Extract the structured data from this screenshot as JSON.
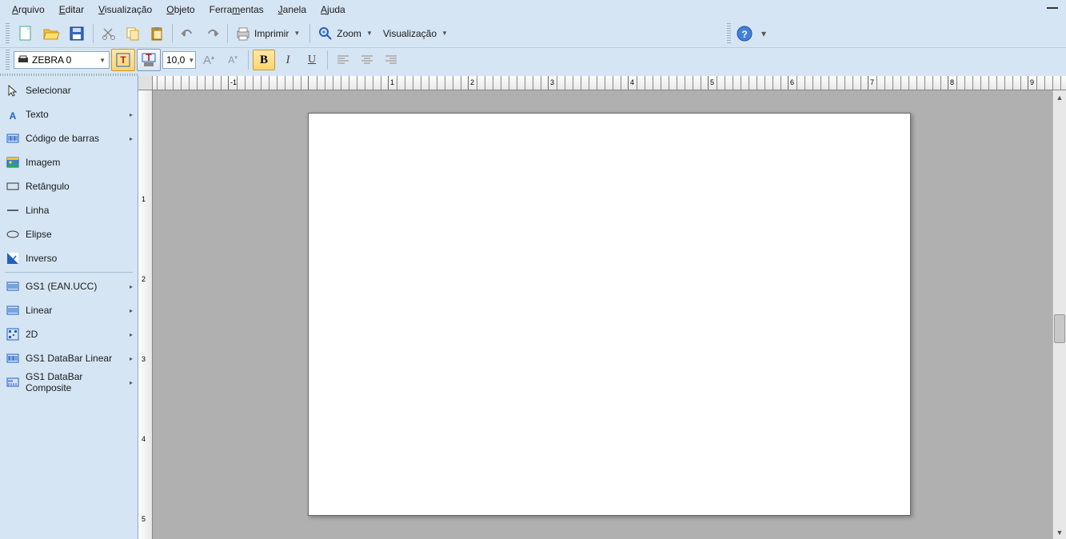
{
  "menu": {
    "arquivo": "Arquivo",
    "editar": "Editar",
    "visualizacao": "Visualização",
    "objeto": "Objeto",
    "ferramentas": "Ferramentas",
    "janela": "Janela",
    "ajuda": "Ajuda"
  },
  "toolbar": {
    "imprimir": "Imprimir",
    "zoom": "Zoom",
    "visualizacao": "Visualização"
  },
  "printer": "ZEBRA 0",
  "fontsize": "10,0",
  "tools": {
    "selecionar": "Selecionar",
    "texto": "Texto",
    "codigo": "Código de barras",
    "imagem": "Imagem",
    "retangulo": "Retângulo",
    "linha": "Linha",
    "elipse": "Elipse",
    "inverso": "Inverso",
    "gs1ean": "GS1 (EAN.UCC)",
    "linear": "Linear",
    "2d": "2D",
    "databarlinear": "GS1 DataBar Linear",
    "databarcomp": "GS1 DataBar Composite"
  },
  "ruler": {
    "neg1": "-1",
    "r1": "1",
    "r2": "2",
    "r3": "3",
    "r4": "4",
    "r5": "5",
    "r6": "6",
    "r7": "7",
    "r8": "8",
    "r9": "9"
  },
  "chart_data": null
}
